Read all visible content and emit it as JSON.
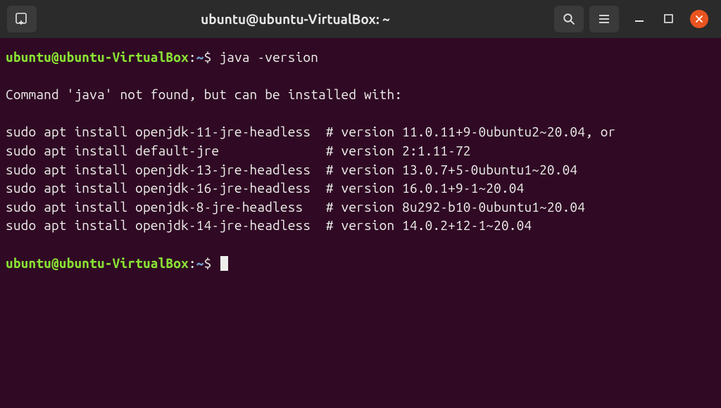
{
  "window": {
    "title": "ubuntu@ubuntu-VirtualBox: ~"
  },
  "prompt": {
    "user_host": "ubuntu@ubuntu-VirtualBox",
    "colon": ":",
    "path": "~",
    "symbol": "$"
  },
  "command": "java -version",
  "output": {
    "header": "Command 'java' not found, but can be installed with:",
    "line1": "sudo apt install openjdk-11-jre-headless  # version 11.0.11+9-0ubuntu2~20.04, or",
    "line2": "sudo apt install default-jre              # version 2:1.11-72",
    "line3": "sudo apt install openjdk-13-jre-headless  # version 13.0.7+5-0ubuntu1~20.04",
    "line4": "sudo apt install openjdk-16-jre-headless  # version 16.0.1+9-1~20.04",
    "line5": "sudo apt install openjdk-8-jre-headless   # version 8u292-b10-0ubuntu1~20.04",
    "line6": "sudo apt install openjdk-14-jre-headless  # version 14.0.2+12-1~20.04"
  }
}
